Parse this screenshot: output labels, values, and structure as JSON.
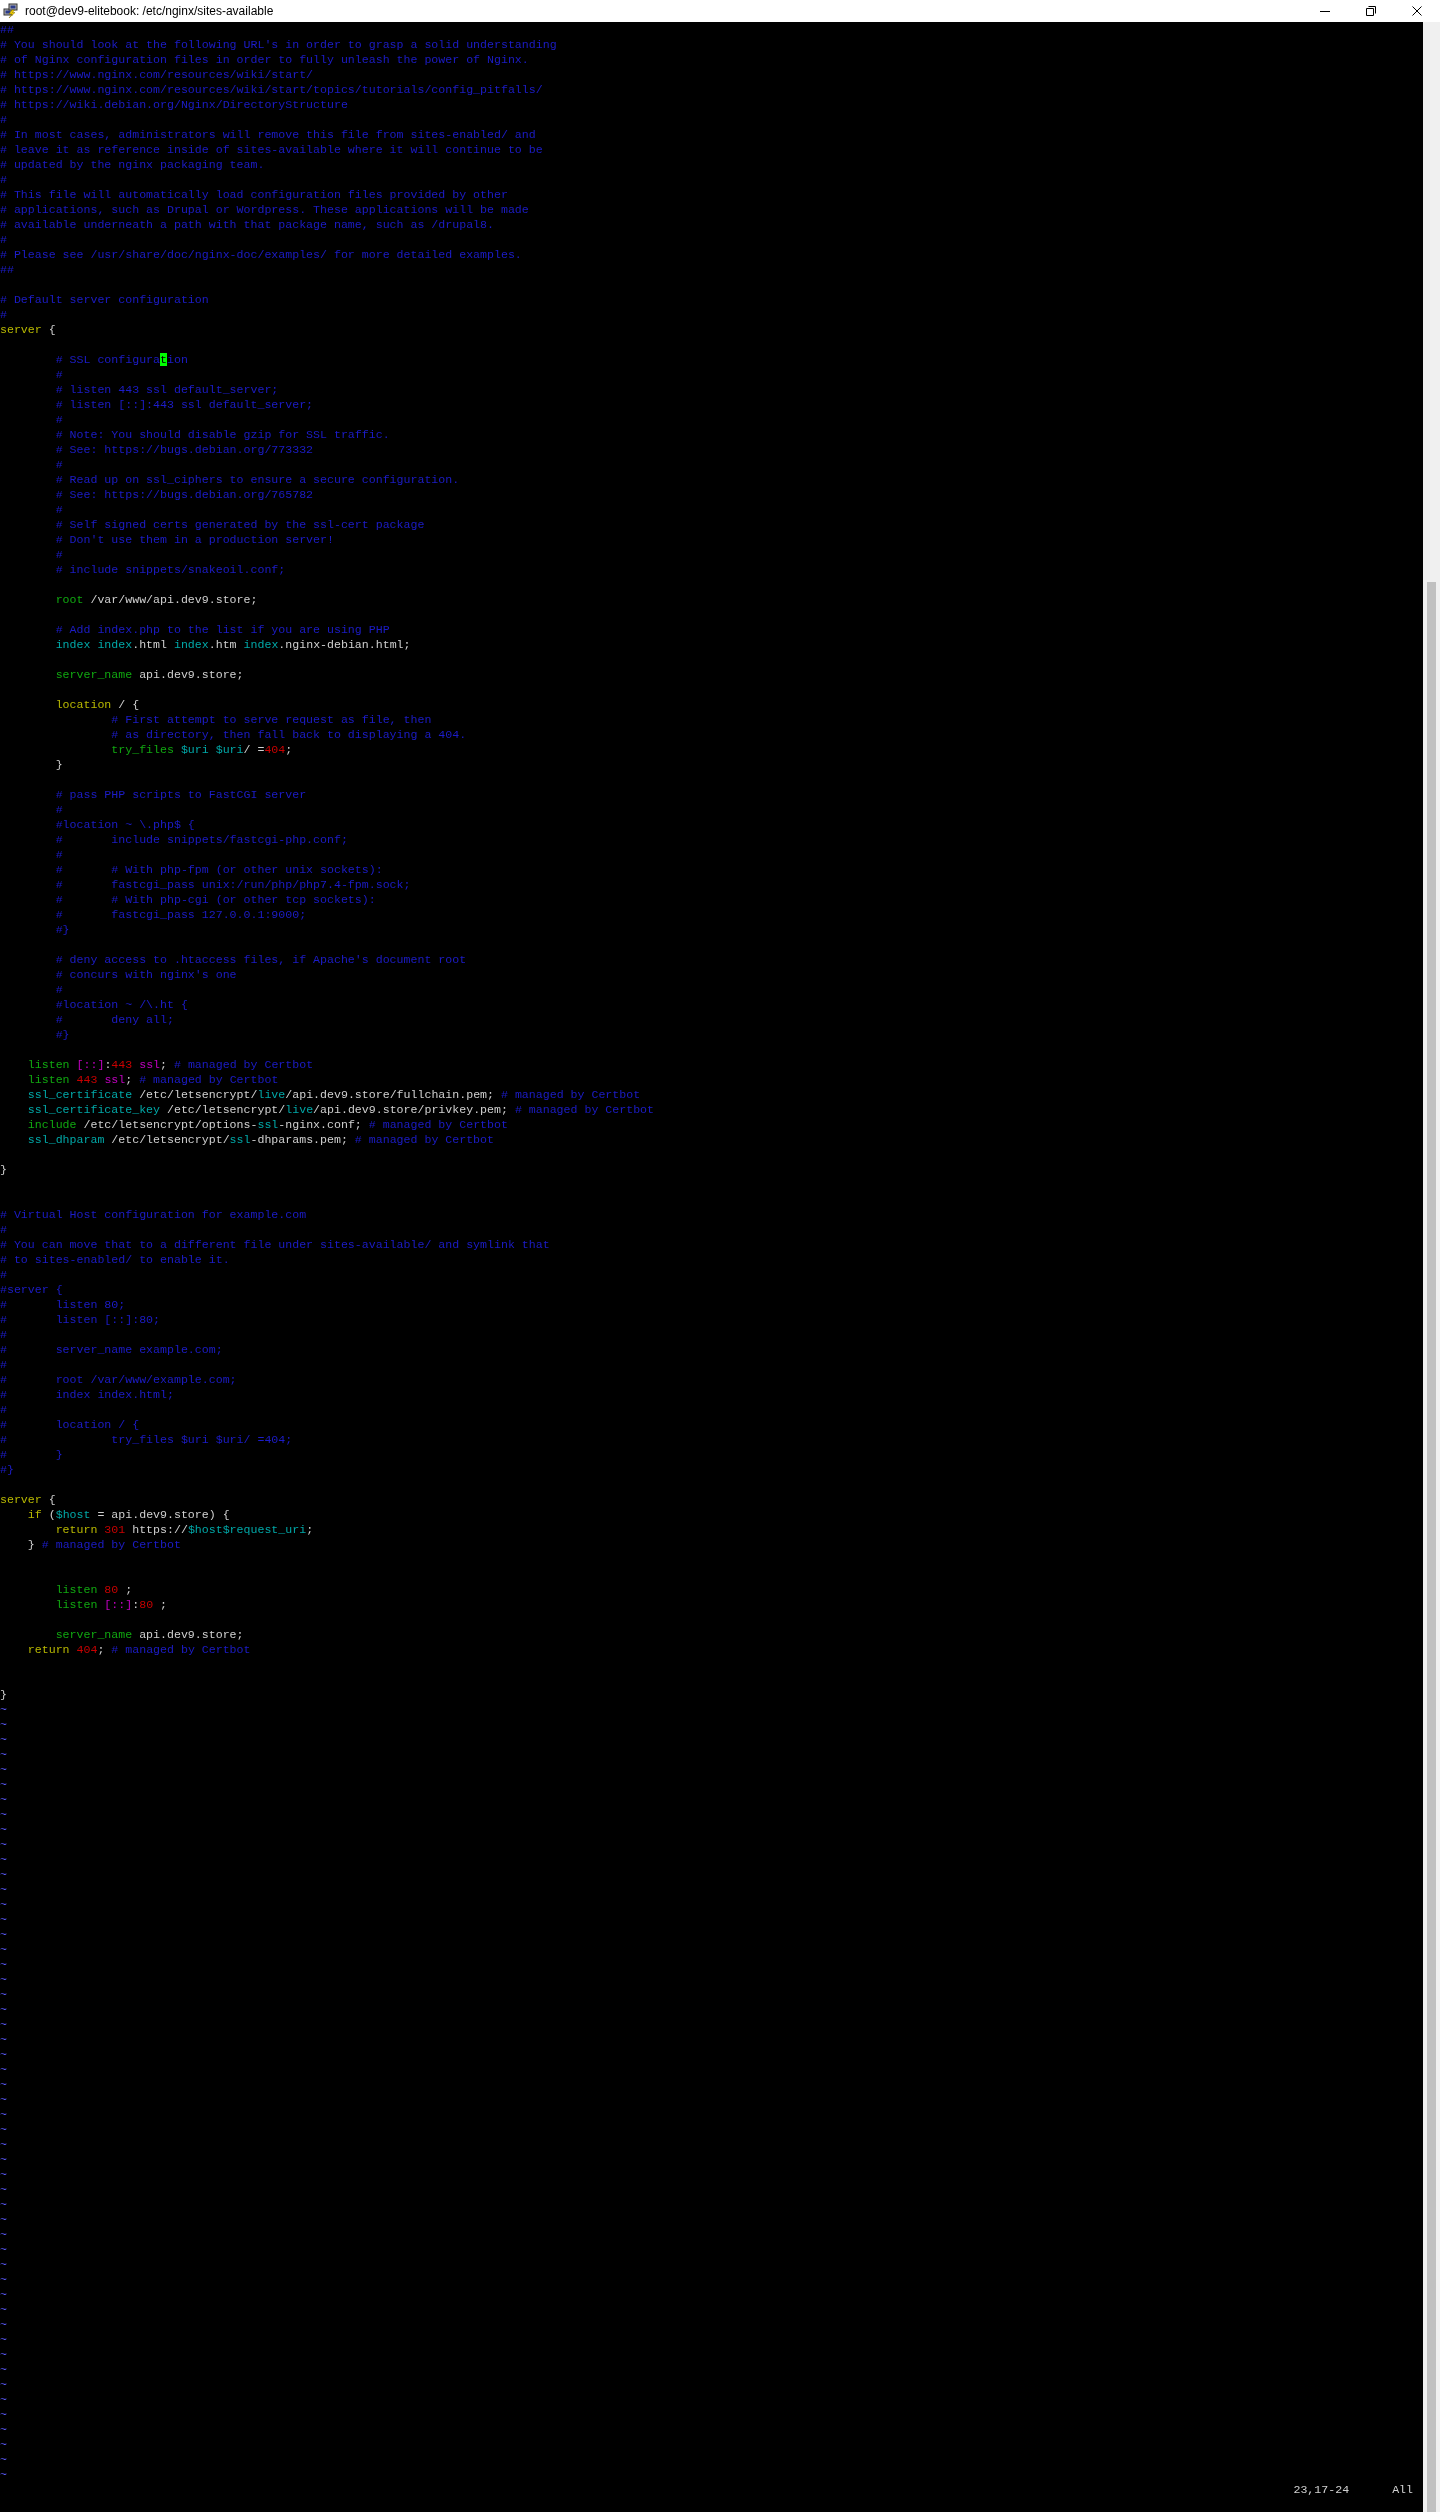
{
  "window": {
    "title": "root@dev9-elitebook: /etc/nginx/sites-available"
  },
  "lines": [
    {
      "kind": "code",
      "segments": [
        {
          "text": "##",
          "kind": "comment"
        }
      ]
    },
    {
      "kind": "code",
      "segments": [
        {
          "text": "# You should look at the following URL's in order to grasp a solid understanding",
          "kind": "comment"
        }
      ]
    },
    {
      "kind": "code",
      "segments": [
        {
          "text": "# of Nginx configuration files in order to fully unleash the power of Nginx.",
          "kind": "comment"
        }
      ]
    },
    {
      "kind": "code",
      "segments": [
        {
          "text": "# https://www.nginx.com/resources/wiki/start/",
          "kind": "comment"
        }
      ]
    },
    {
      "kind": "code",
      "segments": [
        {
          "text": "# https://www.nginx.com/resources/wiki/start/topics/tutorials/config_pitfalls/",
          "kind": "comment"
        }
      ]
    },
    {
      "kind": "code",
      "segments": [
        {
          "text": "# https://wiki.debian.org/Nginx/DirectoryStructure",
          "kind": "comment"
        }
      ]
    },
    {
      "kind": "code",
      "segments": [
        {
          "text": "#",
          "kind": "comment"
        }
      ]
    },
    {
      "kind": "code",
      "segments": [
        {
          "text": "# In most cases, administrators will remove this file from sites-enabled/ and",
          "kind": "comment"
        }
      ]
    },
    {
      "kind": "code",
      "segments": [
        {
          "text": "# leave it as reference inside of sites-available where it will continue to be",
          "kind": "comment"
        }
      ]
    },
    {
      "kind": "code",
      "segments": [
        {
          "text": "# updated by the nginx packaging team.",
          "kind": "comment"
        }
      ]
    },
    {
      "kind": "code",
      "segments": [
        {
          "text": "#",
          "kind": "comment"
        }
      ]
    },
    {
      "kind": "code",
      "segments": [
        {
          "text": "# This file will automatically load configuration files provided by other",
          "kind": "comment"
        }
      ]
    },
    {
      "kind": "code",
      "segments": [
        {
          "text": "# applications, such as Drupal or Wordpress. These applications will be made",
          "kind": "comment"
        }
      ]
    },
    {
      "kind": "code",
      "segments": [
        {
          "text": "# available underneath a path with that package name, such as /drupal8.",
          "kind": "comment"
        }
      ]
    },
    {
      "kind": "code",
      "segments": [
        {
          "text": "#",
          "kind": "comment"
        }
      ]
    },
    {
      "kind": "code",
      "segments": [
        {
          "text": "# Please see /usr/share/doc/nginx-doc/examples/ for more detailed examples.",
          "kind": "comment"
        }
      ]
    },
    {
      "kind": "code",
      "segments": [
        {
          "text": "##",
          "kind": "comment"
        }
      ]
    },
    {
      "kind": "blank"
    },
    {
      "kind": "code",
      "segments": [
        {
          "text": "# Default server configuration",
          "kind": "comment"
        }
      ]
    },
    {
      "kind": "code",
      "segments": [
        {
          "text": "#",
          "kind": "comment"
        }
      ]
    },
    {
      "kind": "code",
      "segments": [
        {
          "text": "server",
          "kind": "block"
        },
        {
          "text": " {",
          "kind": "plain"
        }
      ]
    },
    {
      "kind": "blank"
    },
    {
      "kind": "code",
      "segments": [
        {
          "text": "        # SSL configura",
          "kind": "comment"
        },
        {
          "text": "t",
          "kind": "cursor"
        },
        {
          "text": "ion",
          "kind": "comment"
        }
      ]
    },
    {
      "kind": "code",
      "segments": [
        {
          "text": "        #",
          "kind": "comment"
        }
      ]
    },
    {
      "kind": "code",
      "segments": [
        {
          "text": "        # listen 443 ssl default_server;",
          "kind": "comment"
        }
      ]
    },
    {
      "kind": "code",
      "segments": [
        {
          "text": "        # listen [::]:443 ssl default_server;",
          "kind": "comment"
        }
      ]
    },
    {
      "kind": "code",
      "segments": [
        {
          "text": "        #",
          "kind": "comment"
        }
      ]
    },
    {
      "kind": "code",
      "segments": [
        {
          "text": "        # Note: You should disable gzip for SSL traffic.",
          "kind": "comment"
        }
      ]
    },
    {
      "kind": "code",
      "segments": [
        {
          "text": "        # See: https://bugs.debian.org/773332",
          "kind": "comment"
        }
      ]
    },
    {
      "kind": "code",
      "segments": [
        {
          "text": "        #",
          "kind": "comment"
        }
      ]
    },
    {
      "kind": "code",
      "segments": [
        {
          "text": "        # Read up on ssl_ciphers to ensure a secure configuration.",
          "kind": "comment"
        }
      ]
    },
    {
      "kind": "code",
      "segments": [
        {
          "text": "        # See: https://bugs.debian.org/765782",
          "kind": "comment"
        }
      ]
    },
    {
      "kind": "code",
      "segments": [
        {
          "text": "        #",
          "kind": "comment"
        }
      ]
    },
    {
      "kind": "code",
      "segments": [
        {
          "text": "        # Self signed certs generated by the ssl-cert package",
          "kind": "comment"
        }
      ]
    },
    {
      "kind": "code",
      "segments": [
        {
          "text": "        # Don't use them in a production server!",
          "kind": "comment"
        }
      ]
    },
    {
      "kind": "code",
      "segments": [
        {
          "text": "        #",
          "kind": "comment"
        }
      ]
    },
    {
      "kind": "code",
      "segments": [
        {
          "text": "        # include snippets/snakeoil.conf;",
          "kind": "comment"
        }
      ]
    },
    {
      "kind": "blank"
    },
    {
      "kind": "code",
      "segments": [
        {
          "text": "        root",
          "kind": "directive"
        },
        {
          "text": " /var/www/api.dev9.store;",
          "kind": "plain"
        }
      ]
    },
    {
      "kind": "blank"
    },
    {
      "kind": "code",
      "segments": [
        {
          "text": "        # Add index.php to the list if you are using PHP",
          "kind": "comment"
        }
      ]
    },
    {
      "kind": "code",
      "segments": [
        {
          "text": "        index index",
          "kind": "variable"
        },
        {
          "text": ".html ",
          "kind": "plain"
        },
        {
          "text": "index",
          "kind": "variable"
        },
        {
          "text": ".htm ",
          "kind": "plain"
        },
        {
          "text": "index",
          "kind": "variable"
        },
        {
          "text": ".nginx-debian.html;",
          "kind": "plain"
        }
      ]
    },
    {
      "kind": "blank"
    },
    {
      "kind": "code",
      "segments": [
        {
          "text": "        server_name",
          "kind": "directive"
        },
        {
          "text": " api.dev9.store;",
          "kind": "plain"
        }
      ]
    },
    {
      "kind": "blank"
    },
    {
      "kind": "code",
      "segments": [
        {
          "text": "        location",
          "kind": "block"
        },
        {
          "text": " / {",
          "kind": "plain"
        }
      ]
    },
    {
      "kind": "code",
      "segments": [
        {
          "text": "                # First attempt to serve request as file, then",
          "kind": "comment"
        }
      ]
    },
    {
      "kind": "code",
      "segments": [
        {
          "text": "                # as directory, then fall back to displaying a 404.",
          "kind": "comment"
        }
      ]
    },
    {
      "kind": "code",
      "segments": [
        {
          "text": "                try_files",
          "kind": "directive"
        },
        {
          "text": " $uri $uri",
          "kind": "variable"
        },
        {
          "text": "/ =",
          "kind": "plain"
        },
        {
          "text": "404",
          "kind": "number"
        },
        {
          "text": ";",
          "kind": "plain"
        }
      ]
    },
    {
      "kind": "code",
      "segments": [
        {
          "text": "        }",
          "kind": "plain"
        }
      ]
    },
    {
      "kind": "blank"
    },
    {
      "kind": "code",
      "segments": [
        {
          "text": "        # pass PHP scripts to FastCGI server",
          "kind": "comment"
        }
      ]
    },
    {
      "kind": "code",
      "segments": [
        {
          "text": "        #",
          "kind": "comment"
        }
      ]
    },
    {
      "kind": "code",
      "segments": [
        {
          "text": "        #location ~ \\.php$ {",
          "kind": "comment"
        }
      ]
    },
    {
      "kind": "code",
      "segments": [
        {
          "text": "        #       include snippets/fastcgi-php.conf;",
          "kind": "comment"
        }
      ]
    },
    {
      "kind": "code",
      "segments": [
        {
          "text": "        #",
          "kind": "comment"
        }
      ]
    },
    {
      "kind": "code",
      "segments": [
        {
          "text": "        #       # With php-fpm (or other unix sockets):",
          "kind": "comment"
        }
      ]
    },
    {
      "kind": "code",
      "segments": [
        {
          "text": "        #       fastcgi_pass unix:/run/php/php7.4-fpm.sock;",
          "kind": "comment"
        }
      ]
    },
    {
      "kind": "code",
      "segments": [
        {
          "text": "        #       # With php-cgi (or other tcp sockets):",
          "kind": "comment"
        }
      ]
    },
    {
      "kind": "code",
      "segments": [
        {
          "text": "        #       fastcgi_pass 127.0.0.1:9000;",
          "kind": "comment"
        }
      ]
    },
    {
      "kind": "code",
      "segments": [
        {
          "text": "        #}",
          "kind": "comment"
        }
      ]
    },
    {
      "kind": "blank"
    },
    {
      "kind": "code",
      "segments": [
        {
          "text": "        # deny access to .htaccess files, if Apache's document root",
          "kind": "comment"
        }
      ]
    },
    {
      "kind": "code",
      "segments": [
        {
          "text": "        # concurs with nginx's one",
          "kind": "comment"
        }
      ]
    },
    {
      "kind": "code",
      "segments": [
        {
          "text": "        #",
          "kind": "comment"
        }
      ]
    },
    {
      "kind": "code",
      "segments": [
        {
          "text": "        #location ~ /\\.ht {",
          "kind": "comment"
        }
      ]
    },
    {
      "kind": "code",
      "segments": [
        {
          "text": "        #       deny all;",
          "kind": "comment"
        }
      ]
    },
    {
      "kind": "code",
      "segments": [
        {
          "text": "        #}",
          "kind": "comment"
        }
      ]
    },
    {
      "kind": "blank"
    },
    {
      "kind": "code",
      "segments": [
        {
          "text": "    listen",
          "kind": "directive"
        },
        {
          "text": " [::]",
          "kind": "special"
        },
        {
          "text": ":",
          "kind": "plain"
        },
        {
          "text": "443",
          "kind": "number"
        },
        {
          "text": " ssl",
          "kind": "special"
        },
        {
          "text": ";",
          "kind": "plain"
        },
        {
          "text": " # managed by Certbot",
          "kind": "comment"
        }
      ]
    },
    {
      "kind": "code",
      "segments": [
        {
          "text": "    listen",
          "kind": "directive"
        },
        {
          "text": " 443",
          "kind": "number"
        },
        {
          "text": " ssl",
          "kind": "special"
        },
        {
          "text": ";",
          "kind": "plain"
        },
        {
          "text": " # managed by Certbot",
          "kind": "comment"
        }
      ]
    },
    {
      "kind": "code",
      "segments": [
        {
          "text": "    ssl_certificate",
          "kind": "variable"
        },
        {
          "text": " /etc/letsencrypt/",
          "kind": "plain"
        },
        {
          "text": "live",
          "kind": "variable"
        },
        {
          "text": "/api.dev9.store/fullchain.pem;",
          "kind": "plain"
        },
        {
          "text": " # managed by Certbot",
          "kind": "comment"
        }
      ]
    },
    {
      "kind": "code",
      "segments": [
        {
          "text": "    ssl_certificate_key",
          "kind": "variable"
        },
        {
          "text": " /etc/letsencrypt/",
          "kind": "plain"
        },
        {
          "text": "live",
          "kind": "variable"
        },
        {
          "text": "/api.dev9.store/privkey.pem;",
          "kind": "plain"
        },
        {
          "text": " # managed by Certbot",
          "kind": "comment"
        }
      ]
    },
    {
      "kind": "code",
      "segments": [
        {
          "text": "    include",
          "kind": "directive"
        },
        {
          "text": " /etc/letsencrypt/options-",
          "kind": "plain"
        },
        {
          "text": "ssl",
          "kind": "variable"
        },
        {
          "text": "-nginx.conf;",
          "kind": "plain"
        },
        {
          "text": " # managed by Certbot",
          "kind": "comment"
        }
      ]
    },
    {
      "kind": "code",
      "segments": [
        {
          "text": "    ssl_dhparam",
          "kind": "variable"
        },
        {
          "text": " /etc/letsencrypt/",
          "kind": "plain"
        },
        {
          "text": "ssl",
          "kind": "variable"
        },
        {
          "text": "-dhparams.pem;",
          "kind": "plain"
        },
        {
          "text": " # managed by Certbot",
          "kind": "comment"
        }
      ]
    },
    {
      "kind": "blank"
    },
    {
      "kind": "code",
      "segments": [
        {
          "text": "}",
          "kind": "plain"
        }
      ]
    },
    {
      "kind": "blank"
    },
    {
      "kind": "blank"
    },
    {
      "kind": "code",
      "segments": [
        {
          "text": "# Virtual Host configuration for example.com",
          "kind": "comment"
        }
      ]
    },
    {
      "kind": "code",
      "segments": [
        {
          "text": "#",
          "kind": "comment"
        }
      ]
    },
    {
      "kind": "code",
      "segments": [
        {
          "text": "# You can move that to a different file under sites-available/ and symlink that",
          "kind": "comment"
        }
      ]
    },
    {
      "kind": "code",
      "segments": [
        {
          "text": "# to sites-enabled/ to enable it.",
          "kind": "comment"
        }
      ]
    },
    {
      "kind": "code",
      "segments": [
        {
          "text": "#",
          "kind": "comment"
        }
      ]
    },
    {
      "kind": "code",
      "segments": [
        {
          "text": "#server {",
          "kind": "comment"
        }
      ]
    },
    {
      "kind": "code",
      "segments": [
        {
          "text": "#       listen 80;",
          "kind": "comment"
        }
      ]
    },
    {
      "kind": "code",
      "segments": [
        {
          "text": "#       listen [::]:80;",
          "kind": "comment"
        }
      ]
    },
    {
      "kind": "code",
      "segments": [
        {
          "text": "#",
          "kind": "comment"
        }
      ]
    },
    {
      "kind": "code",
      "segments": [
        {
          "text": "#       server_name example.com;",
          "kind": "comment"
        }
      ]
    },
    {
      "kind": "code",
      "segments": [
        {
          "text": "#",
          "kind": "comment"
        }
      ]
    },
    {
      "kind": "code",
      "segments": [
        {
          "text": "#       root /var/www/example.com;",
          "kind": "comment"
        }
      ]
    },
    {
      "kind": "code",
      "segments": [
        {
          "text": "#       index index.html;",
          "kind": "comment"
        }
      ]
    },
    {
      "kind": "code",
      "segments": [
        {
          "text": "#",
          "kind": "comment"
        }
      ]
    },
    {
      "kind": "code",
      "segments": [
        {
          "text": "#       location / {",
          "kind": "comment"
        }
      ]
    },
    {
      "kind": "code",
      "segments": [
        {
          "text": "#               try_files $uri $uri/ =404;",
          "kind": "comment"
        }
      ]
    },
    {
      "kind": "code",
      "segments": [
        {
          "text": "#       }",
          "kind": "comment"
        }
      ]
    },
    {
      "kind": "code",
      "segments": [
        {
          "text": "#}",
          "kind": "comment"
        }
      ]
    },
    {
      "kind": "blank"
    },
    {
      "kind": "code",
      "segments": [
        {
          "text": "server",
          "kind": "block"
        },
        {
          "text": " {",
          "kind": "plain"
        }
      ]
    },
    {
      "kind": "code",
      "segments": [
        {
          "text": "    if",
          "kind": "block"
        },
        {
          "text": " (",
          "kind": "plain"
        },
        {
          "text": "$host",
          "kind": "variable"
        },
        {
          "text": " = api.dev9.store) {",
          "kind": "plain"
        }
      ]
    },
    {
      "kind": "code",
      "segments": [
        {
          "text": "        return",
          "kind": "block"
        },
        {
          "text": " 301",
          "kind": "number"
        },
        {
          "text": " https://",
          "kind": "plain"
        },
        {
          "text": "$host$request_uri",
          "kind": "variable"
        },
        {
          "text": ";",
          "kind": "plain"
        }
      ]
    },
    {
      "kind": "code",
      "segments": [
        {
          "text": "    }",
          "kind": "plain"
        },
        {
          "text": " # managed by Certbot",
          "kind": "comment"
        }
      ]
    },
    {
      "kind": "blank"
    },
    {
      "kind": "blank"
    },
    {
      "kind": "code",
      "segments": [
        {
          "text": "        listen",
          "kind": "directive"
        },
        {
          "text": " 80",
          "kind": "number"
        },
        {
          "text": " ;",
          "kind": "plain"
        }
      ]
    },
    {
      "kind": "code",
      "segments": [
        {
          "text": "        listen",
          "kind": "directive"
        },
        {
          "text": " [::]",
          "kind": "special"
        },
        {
          "text": ":",
          "kind": "plain"
        },
        {
          "text": "80",
          "kind": "number"
        },
        {
          "text": " ;",
          "kind": "plain"
        }
      ]
    },
    {
      "kind": "blank"
    },
    {
      "kind": "code",
      "segments": [
        {
          "text": "        server_name",
          "kind": "directive"
        },
        {
          "text": " api.dev9.store;",
          "kind": "plain"
        }
      ]
    },
    {
      "kind": "code",
      "segments": [
        {
          "text": "    return",
          "kind": "block"
        },
        {
          "text": " 404",
          "kind": "number"
        },
        {
          "text": ";",
          "kind": "plain"
        },
        {
          "text": " # managed by Certbot",
          "kind": "comment"
        }
      ]
    },
    {
      "kind": "blank"
    },
    {
      "kind": "blank"
    },
    {
      "kind": "code",
      "segments": [
        {
          "text": "}",
          "kind": "plain"
        }
      ]
    }
  ],
  "tildes": [
    "~",
    "~",
    "~",
    "~",
    "~",
    "~",
    "~",
    "~",
    "~",
    "~",
    "~",
    "~",
    "~",
    "~",
    "~",
    "~",
    "~",
    "~",
    "~",
    "~",
    "~",
    "~",
    "~",
    "~",
    "~",
    "~",
    "~",
    "~",
    "~",
    "~",
    "~",
    "~",
    "~",
    "~",
    "~",
    "~",
    "~",
    "~",
    "~",
    "~",
    "~",
    "~",
    "~",
    "~",
    "~",
    "~",
    "~",
    "~",
    "~",
    "~",
    "~",
    "~"
  ],
  "status_bar": {
    "position": "23,17-24",
    "scroll": "All"
  }
}
